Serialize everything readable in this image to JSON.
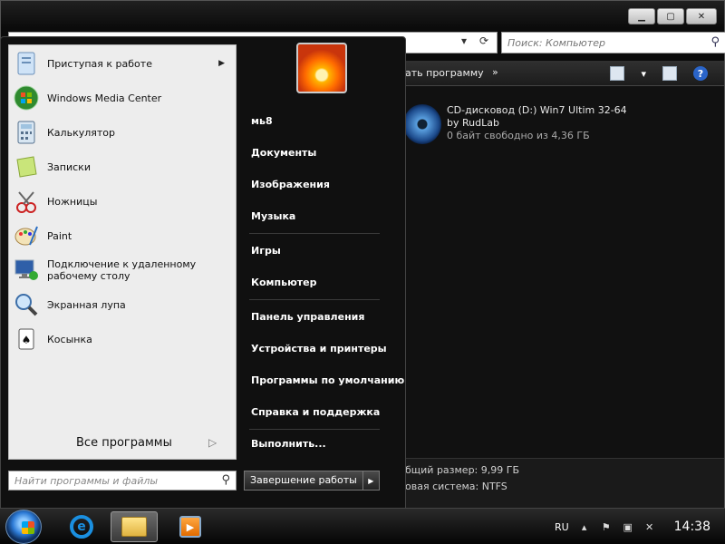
{
  "explorer": {
    "search_placeholder": "Поиск: Компьютер",
    "toolbar_text": "ать программу",
    "toolbar_more": "»",
    "drive": {
      "name": "CD-дисковод (D:) Win7 Ultim 32-64",
      "line2": "by RudLab",
      "free": "0 байт свободно из 4,36 ГБ"
    },
    "details": {
      "total_size": "бщий размер: 9,99 ГБ",
      "filesystem": "овая система: NTFS"
    }
  },
  "start_menu": {
    "programs": [
      {
        "label": "Приступая к работе",
        "icon": "getting-started-icon",
        "has_submenu": true
      },
      {
        "label": "Windows Media Center",
        "icon": "media-center-icon"
      },
      {
        "label": "Калькулятор",
        "icon": "calculator-icon"
      },
      {
        "label": "Записки",
        "icon": "sticky-notes-icon"
      },
      {
        "label": "Ножницы",
        "icon": "snipping-tool-icon"
      },
      {
        "label": "Paint",
        "icon": "paint-icon"
      },
      {
        "label": "Подключение к удаленному рабочему столу",
        "icon": "remote-desktop-icon"
      },
      {
        "label": "Экранная лупа",
        "icon": "magnifier-icon"
      },
      {
        "label": "Косынка",
        "icon": "solitaire-icon"
      }
    ],
    "all_programs": "Все программы",
    "search_placeholder": "Найти программы и файлы",
    "user_name": "мь8",
    "right_items": [
      "Документы",
      "Изображения",
      "Музыка",
      "Игры",
      "Компьютер",
      "Панель управления",
      "Устройства и принтеры",
      "Программы по умолчанию",
      "Справка и поддержка",
      "Выполнить..."
    ],
    "shutdown": "Завершение работы"
  },
  "taskbar": {
    "language": "RU",
    "clock": "14:38"
  }
}
